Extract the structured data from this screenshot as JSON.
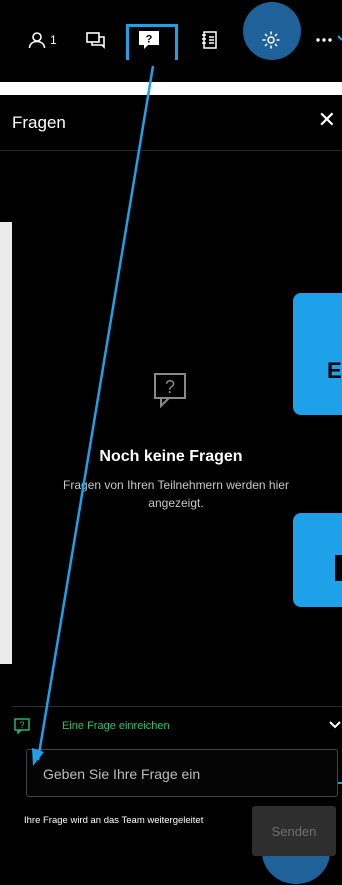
{
  "toolbar": {
    "participant_count": "1",
    "icons": [
      "person-icon",
      "chat-icon",
      "question-icon",
      "notes-icon",
      "gear-icon",
      "more-icon"
    ],
    "accent_color": "#1ea1e8"
  },
  "panel": {
    "title": "Fragen",
    "close_glyph": "✕",
    "empty_state": {
      "title": "Noch keine Fragen",
      "subtitle": "Fragen von Ihren Teilnehmern werden hier angezeigt."
    },
    "submit_section": {
      "label": "Eine Frage einreichen",
      "label_color": "#27c072",
      "input_placeholder": "Geben Sie Ihre Frage ein",
      "note": "Ihre Frage wird an das Team weitergeleitet",
      "send_label": "Senden"
    }
  },
  "side_cards": {
    "card1_text": "E"
  }
}
